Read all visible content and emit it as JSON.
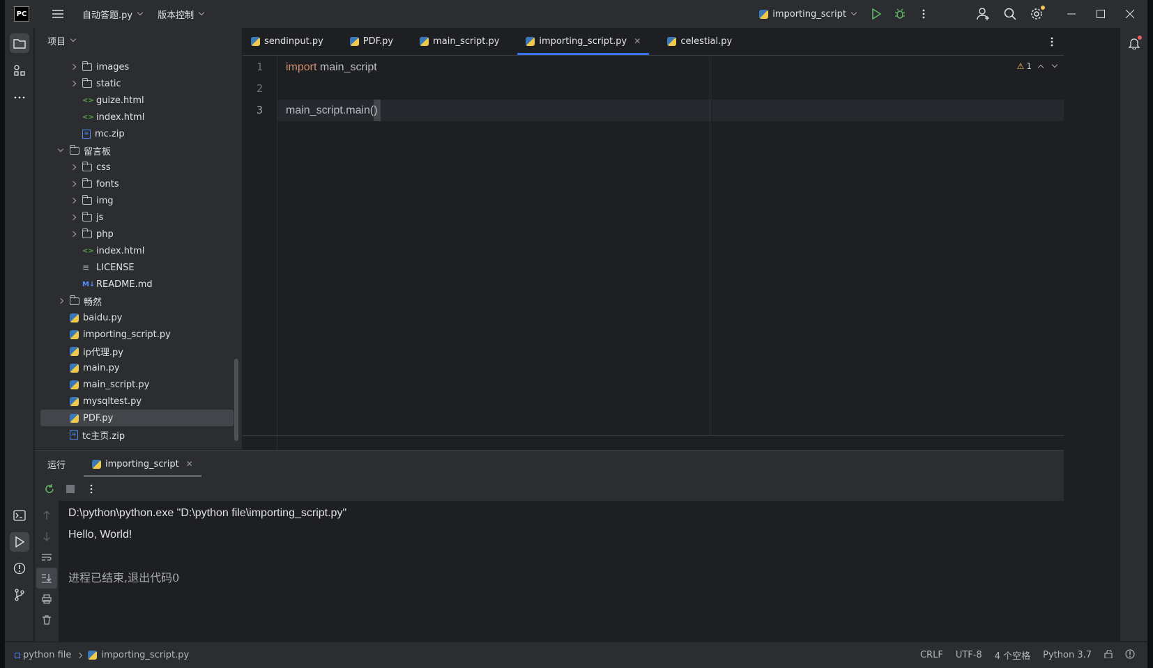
{
  "titlebar": {
    "logo": "PC",
    "project_name": "自动答题.py",
    "vcs": "版本控制",
    "run_config": "importing_script"
  },
  "project": {
    "header": "项目",
    "tree": [
      {
        "name": "images",
        "type": "folder",
        "depth": 2,
        "expanded": false
      },
      {
        "name": "static",
        "type": "folder",
        "depth": 2,
        "expanded": false
      },
      {
        "name": "guize.html",
        "type": "html",
        "depth": 2
      },
      {
        "name": "index.html",
        "type": "html",
        "depth": 2
      },
      {
        "name": "mc.zip",
        "type": "zip",
        "depth": 2
      },
      {
        "name": "留言板",
        "type": "folder",
        "depth": 1,
        "expanded": true
      },
      {
        "name": "css",
        "type": "folder",
        "depth": 2,
        "expanded": false
      },
      {
        "name": "fonts",
        "type": "folder",
        "depth": 2,
        "expanded": false
      },
      {
        "name": "img",
        "type": "folder",
        "depth": 2,
        "expanded": false
      },
      {
        "name": "js",
        "type": "folder",
        "depth": 2,
        "expanded": false
      },
      {
        "name": "php",
        "type": "folder",
        "depth": 2,
        "expanded": false
      },
      {
        "name": "index.html",
        "type": "html",
        "depth": 2
      },
      {
        "name": "LICENSE",
        "type": "text",
        "depth": 2
      },
      {
        "name": "README.md",
        "type": "md",
        "depth": 2
      },
      {
        "name": "畅然",
        "type": "folder",
        "depth": 1,
        "expanded": false
      },
      {
        "name": "baidu.py",
        "type": "py",
        "depth": 1
      },
      {
        "name": "importing_script.py",
        "type": "py",
        "depth": 1
      },
      {
        "name": "ip代理.py",
        "type": "py",
        "depth": 1
      },
      {
        "name": "main.py",
        "type": "py",
        "depth": 1
      },
      {
        "name": "main_script.py",
        "type": "py",
        "depth": 1
      },
      {
        "name": "mysqltest.py",
        "type": "py",
        "depth": 1
      },
      {
        "name": "PDF.py",
        "type": "py",
        "depth": 1,
        "selected": true
      },
      {
        "name": "tc主页.zip",
        "type": "zip",
        "depth": 1
      }
    ]
  },
  "editor": {
    "tabs": [
      {
        "label": "sendinput.py",
        "active": false
      },
      {
        "label": "PDF.py",
        "active": false
      },
      {
        "label": "main_script.py",
        "active": false
      },
      {
        "label": "importing_script.py",
        "active": true
      },
      {
        "label": "celestial.py",
        "active": false
      }
    ],
    "line_numbers": [
      "1",
      "2",
      "3"
    ],
    "lines": {
      "l1_kw": "import",
      "l1_rest": " main_script",
      "l3_code": "main_script.main(",
      "l3_end": ")"
    },
    "warnings": "1"
  },
  "run": {
    "title": "运行",
    "tab": "importing_script",
    "console": [
      "D:\\python\\python.exe \"D:\\python file\\importing_script.py\"",
      "Hello, World!",
      "",
      "进程已结束,退出代码0"
    ]
  },
  "statusbar": {
    "breadcrumb_root": "python file",
    "breadcrumb_file": "importing_script.py",
    "line_sep": "CRLF",
    "encoding": "UTF-8",
    "indent": "4 个空格",
    "interpreter": "Python 3.7"
  },
  "colors": {
    "accent": "#3574f0",
    "keyword": "#cf8e6d",
    "run_green": "#5fb865",
    "debug_green": "#5fb865",
    "warning": "#f2c55c"
  }
}
